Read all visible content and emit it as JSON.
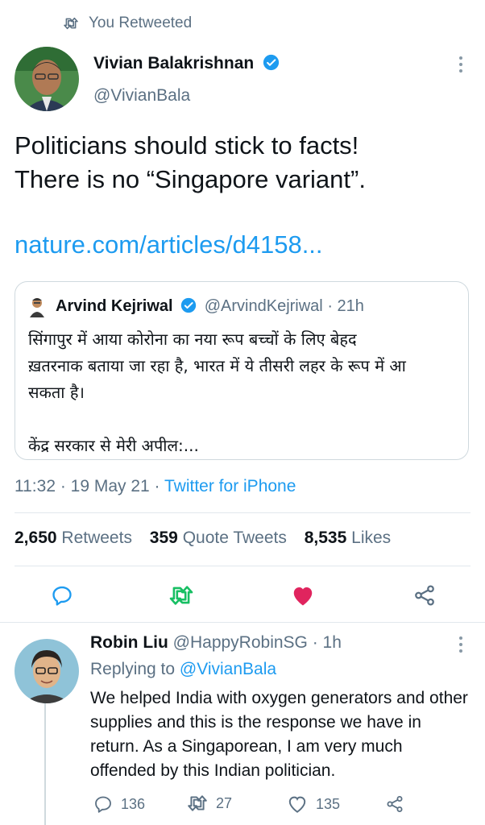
{
  "retweet_header": {
    "label": "You Retweeted"
  },
  "main_tweet": {
    "author_name": "Vivian Balakrishnan",
    "author_handle": "@VivianBala",
    "text_line1": "Politicians should stick to facts!",
    "text_line2": "There is no “Singapore variant”.",
    "link": "nature.com/articles/d4158..."
  },
  "quoted_tweet": {
    "author_name": "Arvind Kejriwal",
    "author_handle": "@ArvindKejriwal",
    "time": "· 21h",
    "text_line1": "सिंगापुर में आया कोरोना का नया रूप बच्चों के लिए बेहद",
    "text_line2": "ख़तरनाक बताया जा रहा है, भारत में ये तीसरी लहर के रूप में आ",
    "text_line3": "सकता है।",
    "text_line4": "केंद्र सरकार से मेरी अपील:..."
  },
  "meta": {
    "time": "11:32 · 19 May 21 · ",
    "client": "Twitter for iPhone"
  },
  "stats": {
    "retweets_count": "2,650",
    "retweets_label": "Retweets",
    "quotes_count": "359",
    "quotes_label": "Quote Tweets",
    "likes_count": "8,535",
    "likes_label": "Likes"
  },
  "reply": {
    "author_name": "Robin Liu",
    "author_handle": "@HappyRobinSG",
    "time": "· 1h",
    "replying_prefix": "Replying to",
    "replying_handle": "@VivianBala",
    "text": "We helped India with oxygen generators and other supplies and this is the response we have in return. As a Singaporean, I am very much offended by this Indian politician.",
    "reply_count": "136",
    "retweet_count": "27",
    "like_count": "135"
  },
  "colors": {
    "accent": "#1d9bf0",
    "retweet_active": "#17bf63",
    "like_active": "#e0245e",
    "secondary_text": "#5b7083"
  }
}
